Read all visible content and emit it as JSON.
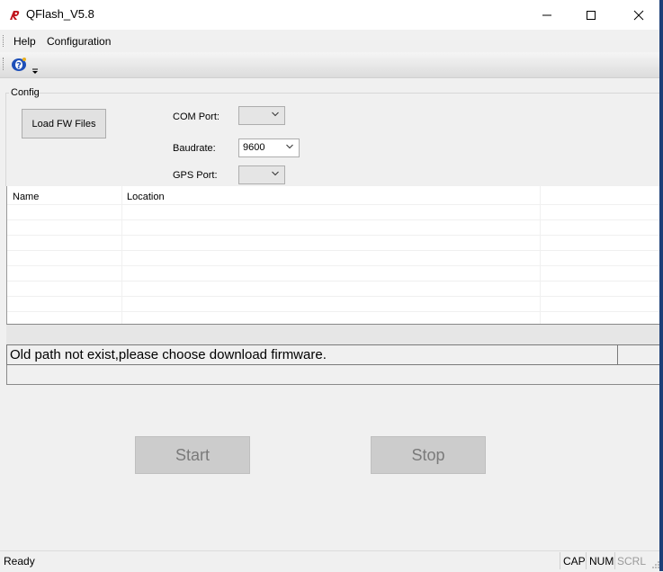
{
  "window": {
    "title": "QFlash_V5.8"
  },
  "menu": {
    "items": [
      "Help",
      "Configuration"
    ]
  },
  "config": {
    "group_label": "Config",
    "load_button": "Load FW Files",
    "com_port_label": "COM Port:",
    "com_port_value": "",
    "baudrate_label": "Baudrate:",
    "baudrate_value": "9600",
    "gps_port_label": "GPS Port:",
    "gps_port_value": ""
  },
  "file_table": {
    "columns": [
      "Name",
      "Location",
      ""
    ],
    "rows": []
  },
  "message": "Old path not exist,please choose download firmware.",
  "actions": {
    "start": "Start",
    "stop": "Stop"
  },
  "statusbar": {
    "status": "Ready",
    "indicators": [
      "CAP",
      "NUM",
      "SCRL"
    ]
  },
  "colors": {
    "title_bar": "#ffffff",
    "window_bg": "#f0f0f0",
    "disabled_button": "#cccccc",
    "border_accent": "#1c3f78"
  }
}
